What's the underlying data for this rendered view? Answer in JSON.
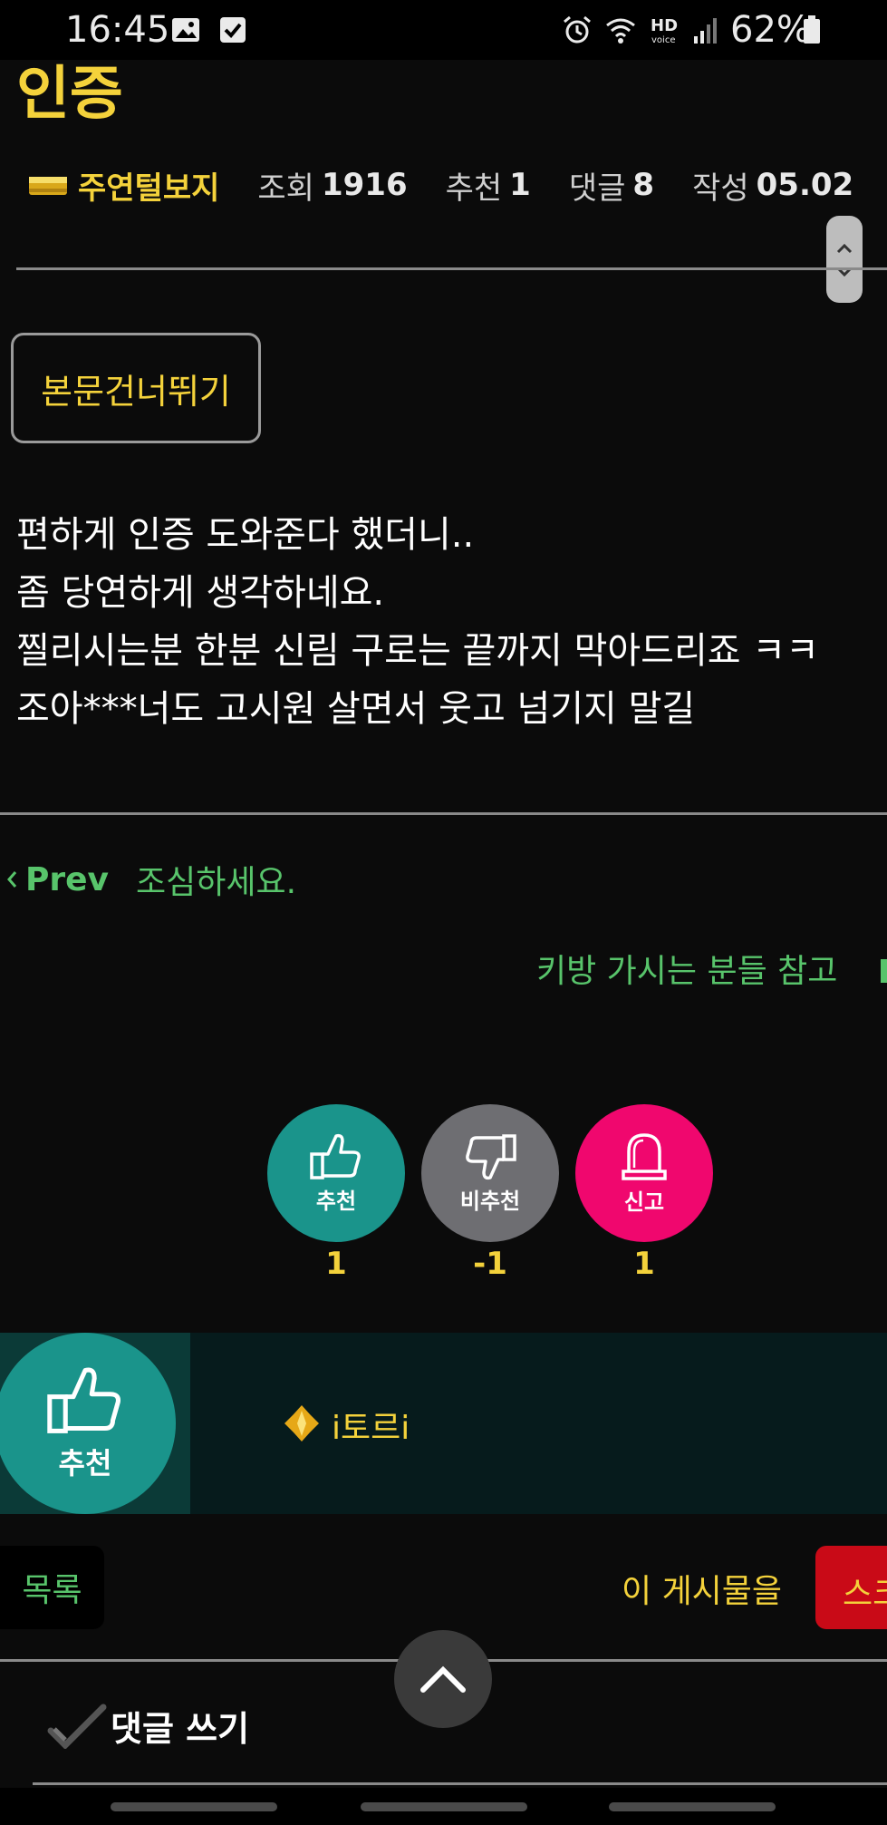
{
  "status_bar": {
    "time": "16:45",
    "battery": "62%",
    "icons": [
      "image-icon",
      "check-icon",
      "alarm-icon",
      "wifi-icon",
      "hd-voice-icon",
      "signal-icon",
      "battery-icon"
    ]
  },
  "post": {
    "title": "인증",
    "author": "주연털보지",
    "meta": {
      "views_label": "조회",
      "views": "1916",
      "recommend_label": "추천",
      "recommend": "1",
      "comments_label": "댓글",
      "comments": "8",
      "date_label": "작성",
      "date": "05.02"
    },
    "skip_button": "본문건너뛰기",
    "body_lines": [
      "편하게 인증 도와준다 했더니..",
      "좀 당연하게 생각하네요.",
      "찔리시는분 한분 신림 구로는 끝까지 막아드리죠 ㅋㅋ",
      "조아***너도 고시원 살면서 웃고 넘기지 말길"
    ]
  },
  "navigation": {
    "prev_label": "Prev",
    "prev_title": "조심하세요.",
    "next_title": "키방 가시는 분들 참고"
  },
  "votes": {
    "up_label": "추천",
    "up_count": "1",
    "down_label": "비추천",
    "down_count": "-1",
    "report_label": "신고",
    "report_count": "1"
  },
  "recommenders": {
    "label": "추천",
    "user": "i토르i"
  },
  "actions": {
    "list_button": "목록",
    "post_action_label": "이 게시물을",
    "scrap_button": "스크"
  },
  "comment": {
    "write_label": "댓글 쓰기"
  },
  "colors": {
    "accent_yellow": "#f4d23b",
    "link_green": "#58c46b",
    "teal": "#1a948b",
    "gray_button": "#6e6e72",
    "report_pink": "#f0076e",
    "scrap_red": "#c90a17",
    "background": "#0b0b0b"
  }
}
